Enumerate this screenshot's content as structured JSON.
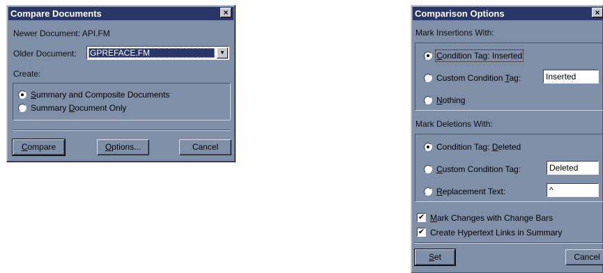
{
  "compare": {
    "title": "Compare Documents",
    "newer_label": "Newer Document:",
    "newer_value": "API.FM",
    "older_label": "Older Document:",
    "older_value": "GPREFACE.FM",
    "create_label": "Create:",
    "options": [
      {
        "pre": "",
        "u": "S",
        "post": "ummary and Composite Documents",
        "selected": true
      },
      {
        "pre": "Summary ",
        "u": "D",
        "post": "ocument Only",
        "selected": false
      }
    ],
    "buttons": {
      "compare": {
        "u": "C",
        "post": "ompare"
      },
      "options": {
        "u": "O",
        "post": "ptions..."
      },
      "cancel": "Cancel"
    }
  },
  "comparison_options": {
    "title": "Comparison Options",
    "insert_label": "Mark Insertions With:",
    "insert_tag": {
      "u": "C",
      "post": "ondition Tag: Inserted",
      "selected": true
    },
    "insert_custom": {
      "pre": "Custom Condition ",
      "u": "T",
      "post": "ag:",
      "value": "Inserted",
      "selected": false
    },
    "insert_nothing": {
      "u": "N",
      "post": "othing",
      "selected": false
    },
    "delete_label": "Mark Deletions With:",
    "delete_tag": {
      "pre": "Condition Tag: ",
      "u": "D",
      "post": "eleted",
      "selected": true
    },
    "delete_custom": {
      "u": "C",
      "post": "ustom Condition Tag:",
      "value": "Deleted",
      "selected": false
    },
    "delete_replace": {
      "u": "R",
      "post": "eplacement Text:",
      "value": "^",
      "selected": false
    },
    "change_bars": {
      "u": "M",
      "post": "ark Changes with Change Bars",
      "checked": true
    },
    "hypertext": {
      "text": "Create Hypertext Links in Summary",
      "checked": true
    },
    "buttons": {
      "set": {
        "u": "S",
        "post": "et"
      },
      "cancel": "Cancel"
    }
  },
  "colors": {
    "dialog_bg": "#7f8fa8",
    "titlebar_bg": "#2a3568",
    "titlebar_text": "#ffffff"
  },
  "icons": {
    "close": "×",
    "dropdown": "▼",
    "check": "✔"
  }
}
